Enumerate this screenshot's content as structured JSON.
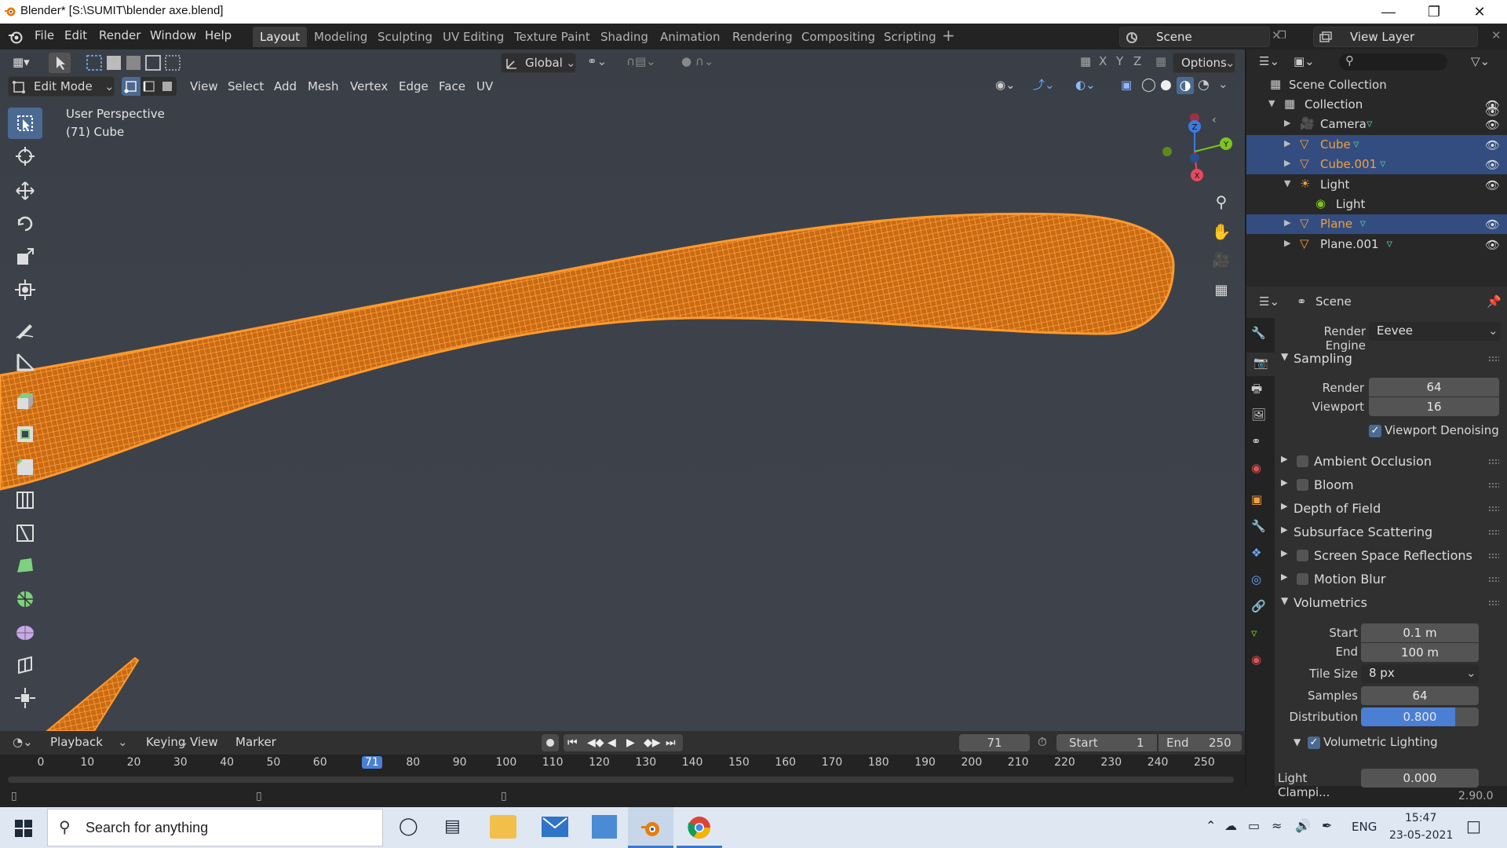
{
  "window": {
    "title": "Blender* [S:\\SUMIT\\blender axe.blend]"
  },
  "menu": [
    "File",
    "Edit",
    "Render",
    "Window",
    "Help"
  ],
  "workspaces": [
    "Layout",
    "Modeling",
    "Sculpting",
    "UV Editing",
    "Texture Paint",
    "Shading",
    "Animation",
    "Rendering",
    "Compositing",
    "Scripting"
  ],
  "active_workspace": "Layout",
  "scene_selector": "Scene",
  "view_layer": "View Layer",
  "viewport": {
    "transform_orientation": "Global",
    "options_label": "Options",
    "axis_locks": [
      "X",
      "Y",
      "Z"
    ],
    "mode": "Edit Mode",
    "header_menus": [
      "View",
      "Select",
      "Add",
      "Mesh",
      "Vertex",
      "Edge",
      "Face",
      "UV"
    ],
    "overlay_text_1": "User Perspective",
    "overlay_text_2": "(71) Cube",
    "gizmo_axes": [
      "Z",
      "Y",
      "X"
    ],
    "mesh_color": "#ff8c1a",
    "background_color": "#3d424a"
  },
  "timeline": {
    "menus": [
      "Playback",
      "Keying",
      "View",
      "Marker"
    ],
    "current_frame": "71",
    "start_label": "Start",
    "start": "1",
    "end_label": "End",
    "end": "250",
    "ruler": [
      "0",
      "10",
      "20",
      "30",
      "40",
      "50",
      "60",
      "71",
      "80",
      "90",
      "100",
      "110",
      "120",
      "130",
      "140",
      "150",
      "160",
      "170",
      "180",
      "190",
      "200",
      "210",
      "220",
      "230",
      "240",
      "250"
    ]
  },
  "outliner": {
    "root": "Scene Collection",
    "items": [
      {
        "label": "Collection",
        "selected": false
      },
      {
        "label": "Camera",
        "selected": false
      },
      {
        "label": "Cube",
        "selected": true
      },
      {
        "label": "Cube.001",
        "selected": true
      },
      {
        "label": "Light",
        "selected": false
      },
      {
        "label": "Light",
        "selected": false
      },
      {
        "label": "Plane",
        "selected": true
      },
      {
        "label": "Plane.001",
        "selected": false
      }
    ]
  },
  "properties": {
    "header": "Scene",
    "render_engine_label": "Render Engine",
    "render_engine": "Eevee",
    "sampling": {
      "title": "Sampling",
      "render_label": "Render",
      "render": "64",
      "viewport_label": "Viewport",
      "viewport": "16",
      "denoise_label": "Viewport Denoising"
    },
    "panels": [
      "Ambient Occlusion",
      "Bloom",
      "Depth of Field",
      "Subsurface Scattering",
      "Screen Space Reflections",
      "Motion Blur"
    ],
    "volumetrics": {
      "title": "Volumetrics",
      "start_label": "Start",
      "start": "0.1 m",
      "end_label": "End",
      "end": "100 m",
      "tile_label": "Tile Size",
      "tile": "8 px",
      "samples_label": "Samples",
      "samples": "64",
      "distribution_label": "Distribution",
      "distribution": "0.800",
      "distribution_fraction": 0.8,
      "lighting_label": "Volumetric Lighting",
      "clamp_label": "Light Clampi...",
      "clamp": "0.000"
    }
  },
  "status": {
    "version": "2.90.0"
  },
  "taskbar": {
    "search_placeholder": "Search for anything",
    "lang": "ENG",
    "time": "15:47",
    "date": "23-05-2021"
  }
}
